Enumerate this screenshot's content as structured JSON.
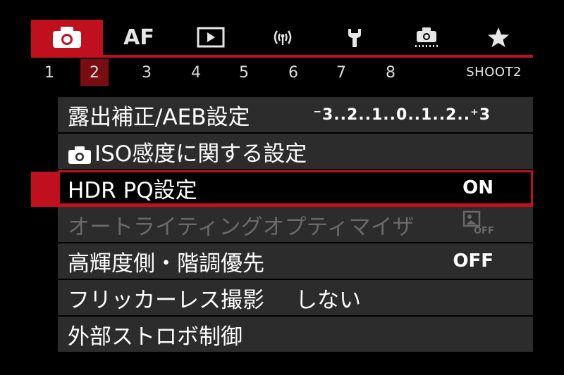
{
  "tabs": [
    {
      "name": "camera",
      "icon": "camera-icon",
      "active": true
    },
    {
      "name": "af",
      "label": "AF"
    },
    {
      "name": "playback",
      "icon": "play-icon"
    },
    {
      "name": "wireless",
      "icon": "wireless-icon"
    },
    {
      "name": "setup",
      "icon": "wrench-icon"
    },
    {
      "name": "custom",
      "icon": "custom-functions-icon"
    },
    {
      "name": "my-menu",
      "icon": "star-icon"
    }
  ],
  "pages": [
    "1",
    "2",
    "3",
    "4",
    "5",
    "6",
    "7",
    "8"
  ],
  "active_page": "2",
  "page_name": "SHOOT2",
  "menu": {
    "items": [
      {
        "label": "露出補正/AEB設定",
        "scale": "⁻3..2..1..0..1..2..⁺3"
      },
      {
        "label": "ISO感度に関する設定"
      },
      {
        "label": "HDR PQ設定",
        "value": "ON"
      },
      {
        "label": "オートライティングオプティマイザ",
        "value_icon": "auto-lighting-off-icon"
      },
      {
        "label": "高輝度側・階調優先",
        "value": "OFF"
      },
      {
        "label": "フリッカーレス撮影",
        "value": "しない"
      },
      {
        "label": "外部ストロボ制御"
      }
    ]
  },
  "colors": {
    "accent": "#c0101e",
    "row_bg": "#2c2c2c",
    "disabled_text": "#6a6a6a"
  }
}
